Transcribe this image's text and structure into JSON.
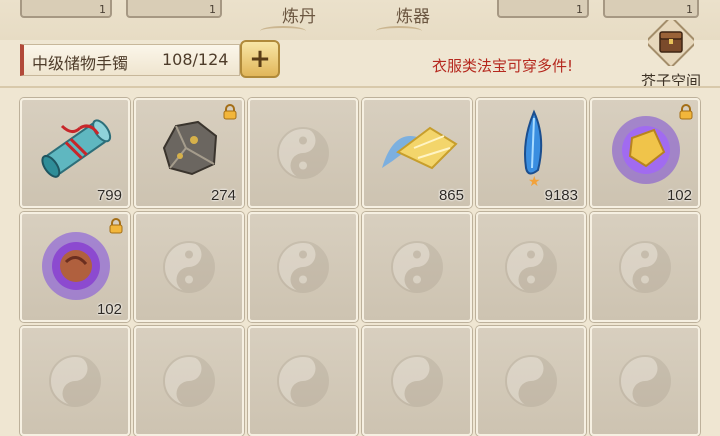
{
  "top": {
    "slots": [
      {
        "count": "1"
      },
      {
        "count": "1"
      },
      {
        "count": "1"
      },
      {
        "count": "1"
      }
    ],
    "tabs": [
      "炼丹",
      "炼器"
    ]
  },
  "bag": {
    "name": "中级储物手镯",
    "count": "108/124",
    "plus": "+",
    "hint": "衣服类法宝可穿多件!",
    "space_label": "芥子空间"
  },
  "items": [
    {
      "icon": "scroll-icon",
      "qty": "799",
      "locked": false
    },
    {
      "icon": "ore-icon",
      "qty": "274",
      "locked": true
    },
    {
      "icon": "empty",
      "qty": "",
      "locked": false
    },
    {
      "icon": "crystal-wing-icon",
      "qty": "865",
      "locked": false
    },
    {
      "icon": "blue-feather-icon",
      "qty": "9183",
      "locked": false,
      "star": true
    },
    {
      "icon": "purple-orb-gold-icon",
      "qty": "102",
      "locked": true
    },
    {
      "icon": "purple-orb-red-icon",
      "qty": "102",
      "locked": true
    },
    {
      "icon": "empty",
      "qty": "",
      "locked": false
    },
    {
      "icon": "empty",
      "qty": "",
      "locked": false
    },
    {
      "icon": "empty",
      "qty": "",
      "locked": false
    },
    {
      "icon": "empty",
      "qty": "",
      "locked": false
    },
    {
      "icon": "empty",
      "qty": "",
      "locked": false
    }
  ],
  "colors": {
    "hint": "#b5281e",
    "accent": "#e1b65a"
  }
}
